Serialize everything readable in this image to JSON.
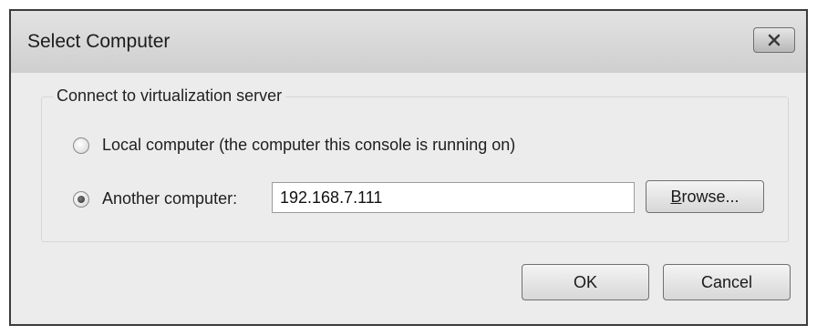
{
  "window": {
    "title": "Select Computer",
    "close_icon": "close-icon"
  },
  "group": {
    "legend": "Connect to virtualization server",
    "local_radio": {
      "label": "Local computer (the computer this console is running on)",
      "checked": false
    },
    "another_radio": {
      "label": "Another computer:",
      "checked": true
    },
    "computer_input": {
      "value": "192.168.7.111"
    },
    "browse_button": {
      "mnemonic": "B",
      "rest": "rowse..."
    }
  },
  "buttons": {
    "ok": "OK",
    "cancel": "Cancel"
  }
}
